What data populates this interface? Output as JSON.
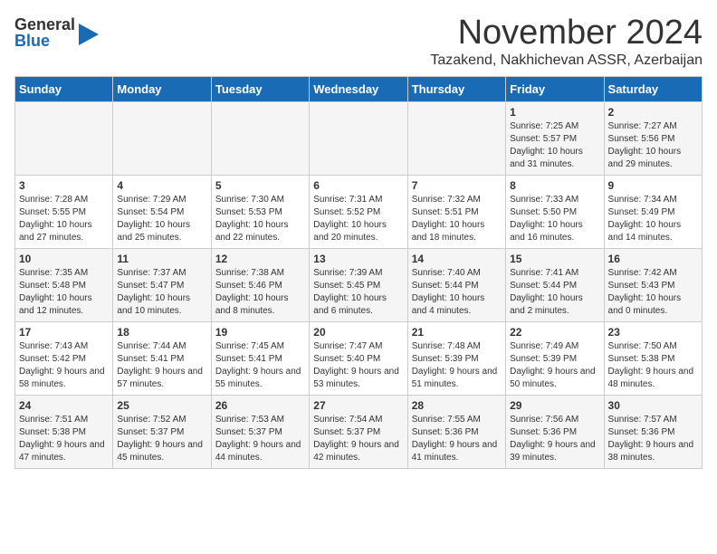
{
  "logo": {
    "general": "General",
    "blue": "Blue"
  },
  "title": "November 2024",
  "location": "Tazakend, Nakhichevan ASSR, Azerbaijan",
  "days_of_week": [
    "Sunday",
    "Monday",
    "Tuesday",
    "Wednesday",
    "Thursday",
    "Friday",
    "Saturday"
  ],
  "weeks": [
    [
      {
        "day": "",
        "info": ""
      },
      {
        "day": "",
        "info": ""
      },
      {
        "day": "",
        "info": ""
      },
      {
        "day": "",
        "info": ""
      },
      {
        "day": "",
        "info": ""
      },
      {
        "day": "1",
        "info": "Sunrise: 7:25 AM\nSunset: 5:57 PM\nDaylight: 10 hours and 31 minutes."
      },
      {
        "day": "2",
        "info": "Sunrise: 7:27 AM\nSunset: 5:56 PM\nDaylight: 10 hours and 29 minutes."
      }
    ],
    [
      {
        "day": "3",
        "info": "Sunrise: 7:28 AM\nSunset: 5:55 PM\nDaylight: 10 hours and 27 minutes."
      },
      {
        "day": "4",
        "info": "Sunrise: 7:29 AM\nSunset: 5:54 PM\nDaylight: 10 hours and 25 minutes."
      },
      {
        "day": "5",
        "info": "Sunrise: 7:30 AM\nSunset: 5:53 PM\nDaylight: 10 hours and 22 minutes."
      },
      {
        "day": "6",
        "info": "Sunrise: 7:31 AM\nSunset: 5:52 PM\nDaylight: 10 hours and 20 minutes."
      },
      {
        "day": "7",
        "info": "Sunrise: 7:32 AM\nSunset: 5:51 PM\nDaylight: 10 hours and 18 minutes."
      },
      {
        "day": "8",
        "info": "Sunrise: 7:33 AM\nSunset: 5:50 PM\nDaylight: 10 hours and 16 minutes."
      },
      {
        "day": "9",
        "info": "Sunrise: 7:34 AM\nSunset: 5:49 PM\nDaylight: 10 hours and 14 minutes."
      }
    ],
    [
      {
        "day": "10",
        "info": "Sunrise: 7:35 AM\nSunset: 5:48 PM\nDaylight: 10 hours and 12 minutes."
      },
      {
        "day": "11",
        "info": "Sunrise: 7:37 AM\nSunset: 5:47 PM\nDaylight: 10 hours and 10 minutes."
      },
      {
        "day": "12",
        "info": "Sunrise: 7:38 AM\nSunset: 5:46 PM\nDaylight: 10 hours and 8 minutes."
      },
      {
        "day": "13",
        "info": "Sunrise: 7:39 AM\nSunset: 5:45 PM\nDaylight: 10 hours and 6 minutes."
      },
      {
        "day": "14",
        "info": "Sunrise: 7:40 AM\nSunset: 5:44 PM\nDaylight: 10 hours and 4 minutes."
      },
      {
        "day": "15",
        "info": "Sunrise: 7:41 AM\nSunset: 5:44 PM\nDaylight: 10 hours and 2 minutes."
      },
      {
        "day": "16",
        "info": "Sunrise: 7:42 AM\nSunset: 5:43 PM\nDaylight: 10 hours and 0 minutes."
      }
    ],
    [
      {
        "day": "17",
        "info": "Sunrise: 7:43 AM\nSunset: 5:42 PM\nDaylight: 9 hours and 58 minutes."
      },
      {
        "day": "18",
        "info": "Sunrise: 7:44 AM\nSunset: 5:41 PM\nDaylight: 9 hours and 57 minutes."
      },
      {
        "day": "19",
        "info": "Sunrise: 7:45 AM\nSunset: 5:41 PM\nDaylight: 9 hours and 55 minutes."
      },
      {
        "day": "20",
        "info": "Sunrise: 7:47 AM\nSunset: 5:40 PM\nDaylight: 9 hours and 53 minutes."
      },
      {
        "day": "21",
        "info": "Sunrise: 7:48 AM\nSunset: 5:39 PM\nDaylight: 9 hours and 51 minutes."
      },
      {
        "day": "22",
        "info": "Sunrise: 7:49 AM\nSunset: 5:39 PM\nDaylight: 9 hours and 50 minutes."
      },
      {
        "day": "23",
        "info": "Sunrise: 7:50 AM\nSunset: 5:38 PM\nDaylight: 9 hours and 48 minutes."
      }
    ],
    [
      {
        "day": "24",
        "info": "Sunrise: 7:51 AM\nSunset: 5:38 PM\nDaylight: 9 hours and 47 minutes."
      },
      {
        "day": "25",
        "info": "Sunrise: 7:52 AM\nSunset: 5:37 PM\nDaylight: 9 hours and 45 minutes."
      },
      {
        "day": "26",
        "info": "Sunrise: 7:53 AM\nSunset: 5:37 PM\nDaylight: 9 hours and 44 minutes."
      },
      {
        "day": "27",
        "info": "Sunrise: 7:54 AM\nSunset: 5:37 PM\nDaylight: 9 hours and 42 minutes."
      },
      {
        "day": "28",
        "info": "Sunrise: 7:55 AM\nSunset: 5:36 PM\nDaylight: 9 hours and 41 minutes."
      },
      {
        "day": "29",
        "info": "Sunrise: 7:56 AM\nSunset: 5:36 PM\nDaylight: 9 hours and 39 minutes."
      },
      {
        "day": "30",
        "info": "Sunrise: 7:57 AM\nSunset: 5:36 PM\nDaylight: 9 hours and 38 minutes."
      }
    ]
  ]
}
